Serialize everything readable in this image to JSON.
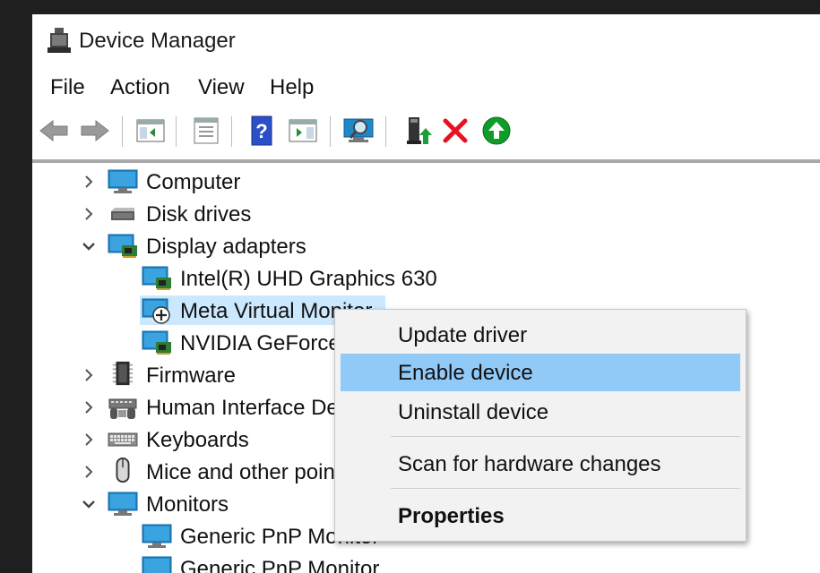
{
  "window": {
    "title": "Device Manager"
  },
  "menu": [
    "File",
    "Action",
    "View",
    "Help"
  ],
  "toolbar": {
    "buttons": [
      "back-icon",
      "forward-icon",
      "show-hide-console-tree-icon",
      "properties-icon",
      "help-icon",
      "action-pane-icon",
      "scan-hardware-icon",
      "update-driver-icon",
      "uninstall-icon",
      "enable-device-icon"
    ]
  },
  "tree": {
    "nodes": [
      {
        "label": "Computer",
        "expanded": false,
        "icon": "computer-icon"
      },
      {
        "label": "Disk drives",
        "expanded": false,
        "icon": "disk-drive-icon"
      },
      {
        "label": "Display adapters",
        "expanded": true,
        "icon": "display-adapter-icon"
      },
      {
        "label": "Intel(R) UHD Graphics 630",
        "child": true,
        "icon": "display-adapter-icon"
      },
      {
        "label": "Meta Virtual Monitor",
        "child": true,
        "selected": true,
        "disabled": true,
        "icon": "disabled-monitor-icon"
      },
      {
        "label": "NVIDIA GeForce",
        "child": true,
        "icon": "display-adapter-icon"
      },
      {
        "label": "Firmware",
        "expanded": false,
        "icon": "firmware-chip-icon"
      },
      {
        "label": "Human Interface Devices",
        "expanded": false,
        "icon": "hid-icon"
      },
      {
        "label": "Keyboards",
        "expanded": false,
        "icon": "keyboard-icon"
      },
      {
        "label": "Mice and other pointing devices",
        "expanded": false,
        "icon": "mouse-icon"
      },
      {
        "label": "Monitors",
        "expanded": true,
        "icon": "monitor-icon"
      },
      {
        "label": "Generic PnP Monitor",
        "child": true,
        "icon": "monitor-icon"
      },
      {
        "label": "Generic PnP Monitor",
        "child": true,
        "icon": "monitor-icon"
      }
    ]
  },
  "context_menu": {
    "items": [
      {
        "label": "Update driver"
      },
      {
        "label": "Enable device",
        "highlighted": true
      },
      {
        "label": "Uninstall device"
      },
      {
        "label": "Scan for hardware changes"
      },
      {
        "label": "Properties",
        "bold": true
      }
    ]
  },
  "colors": {
    "selection": "#cce8ff",
    "menu_highlight": "#91c9f7",
    "uninstall_red": "#e81123",
    "enable_green": "#0f9d2a",
    "help_blue": "#2b4fc7"
  }
}
